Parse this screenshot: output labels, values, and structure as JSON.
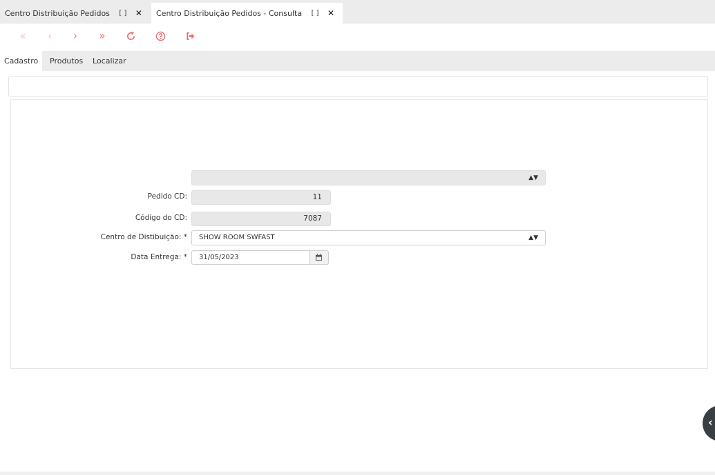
{
  "window_tabs": [
    {
      "label": "Centro Distribuição Pedidos",
      "maximize_icon": "expand-icon",
      "close_icon": "close-icon",
      "active": false
    },
    {
      "label": "Centro Distribuição Pedidos - Consulta",
      "maximize_icon": "expand-icon",
      "close_icon": "close-icon",
      "active": true
    }
  ],
  "toolbar": {
    "buttons": [
      {
        "name": "first-record",
        "glyph": "«",
        "enabled": false
      },
      {
        "name": "previous-record",
        "glyph": "‹",
        "enabled": false
      },
      {
        "name": "next-record",
        "glyph": "›",
        "enabled": true
      },
      {
        "name": "last-record",
        "glyph": "»",
        "enabled": true
      },
      {
        "name": "refresh",
        "icon": "refresh-icon",
        "enabled": true
      },
      {
        "name": "help",
        "icon": "help-icon",
        "enabled": true
      },
      {
        "name": "exit",
        "icon": "exit-icon",
        "enabled": true
      }
    ],
    "accent_color": "#ee6f6f"
  },
  "form_tabs": [
    {
      "label": "Cadastro",
      "active": true
    },
    {
      "label": "Produtos",
      "active": false
    },
    {
      "label": "Localizar",
      "active": false
    }
  ],
  "form": {
    "top_select": {
      "value": ""
    },
    "pedido_cd": {
      "label": "Pedido CD:",
      "value": "11"
    },
    "codigo_cd": {
      "label": "Código do CD:",
      "value": "7087"
    },
    "centro": {
      "label": "Centro de Distibuição: *",
      "value": "SHOW ROOM SWFAST"
    },
    "data_entrega": {
      "label": "Data Entrega: *",
      "value": "31/05/2023"
    }
  },
  "side_handle": {
    "glyph": "‹"
  }
}
